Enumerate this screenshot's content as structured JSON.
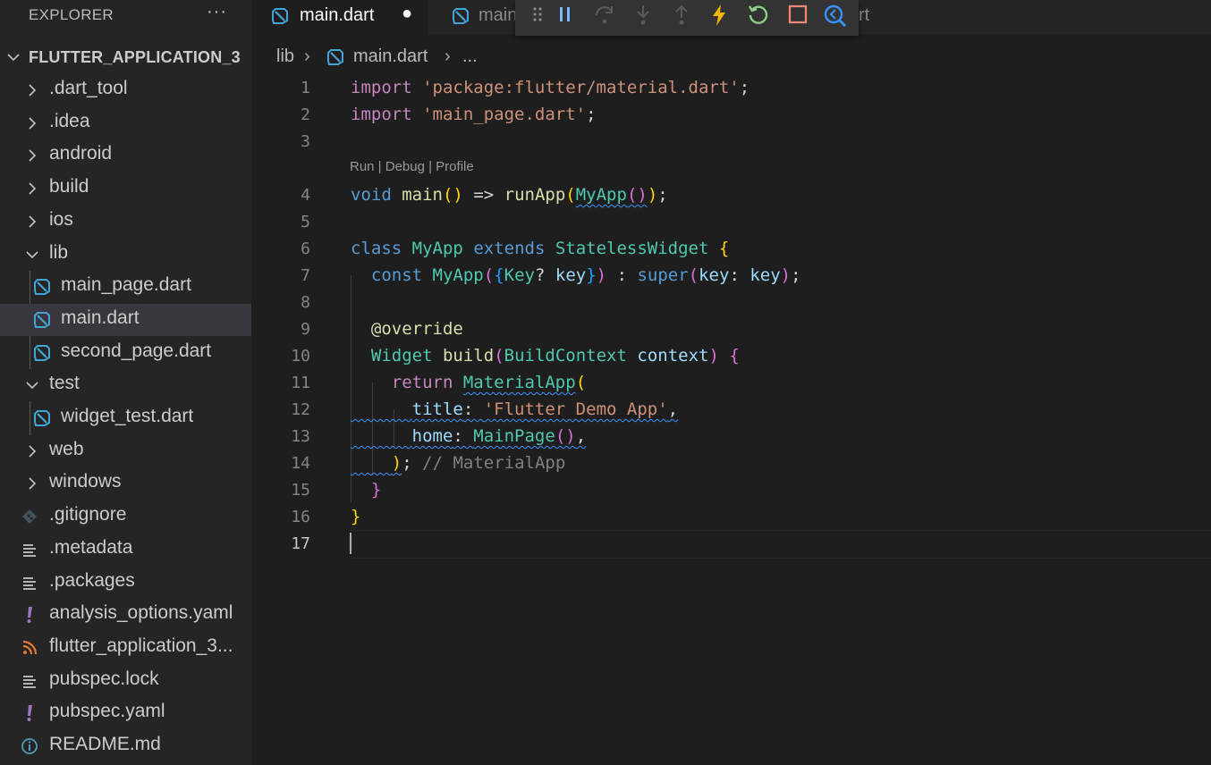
{
  "explorer": {
    "header": "EXPLORER",
    "more": "···",
    "root": "FLUTTER_APPLICATION_3",
    "items": [
      {
        "label": ".dart_tool",
        "kind": "folder",
        "expanded": false,
        "depth": 1
      },
      {
        "label": ".idea",
        "kind": "folder",
        "expanded": false,
        "depth": 1
      },
      {
        "label": "android",
        "kind": "folder",
        "expanded": false,
        "depth": 1
      },
      {
        "label": "build",
        "kind": "folder",
        "expanded": false,
        "depth": 1
      },
      {
        "label": "ios",
        "kind": "folder",
        "expanded": false,
        "depth": 1
      },
      {
        "label": "lib",
        "kind": "folder",
        "expanded": true,
        "depth": 1
      },
      {
        "label": "main_page.dart",
        "kind": "dart",
        "depth": 2
      },
      {
        "label": "main.dart",
        "kind": "dart",
        "depth": 2,
        "selected": true
      },
      {
        "label": "second_page.dart",
        "kind": "dart",
        "depth": 2
      },
      {
        "label": "test",
        "kind": "folder",
        "expanded": true,
        "depth": 1
      },
      {
        "label": "widget_test.dart",
        "kind": "dart",
        "depth": 2
      },
      {
        "label": "web",
        "kind": "folder",
        "expanded": false,
        "depth": 1
      },
      {
        "label": "windows",
        "kind": "folder",
        "expanded": false,
        "depth": 1
      },
      {
        "label": ".gitignore",
        "kind": "git",
        "depth": 1
      },
      {
        "label": ".metadata",
        "kind": "lines",
        "depth": 1
      },
      {
        "label": ".packages",
        "kind": "lines",
        "depth": 1
      },
      {
        "label": "analysis_options.yaml",
        "kind": "yaml",
        "depth": 1
      },
      {
        "label": "flutter_application_3...",
        "kind": "rss",
        "depth": 1
      },
      {
        "label": "pubspec.lock",
        "kind": "lines",
        "depth": 1
      },
      {
        "label": "pubspec.yaml",
        "kind": "yaml",
        "depth": 1
      },
      {
        "label": "README.md",
        "kind": "info",
        "depth": 1
      }
    ]
  },
  "tabs": {
    "active": {
      "label": "main.dart",
      "dirty": "●"
    },
    "second": {
      "label": "main"
    },
    "tail": "rt"
  },
  "breadcrumb": {
    "folder": "lib",
    "sep1": "›",
    "file": "main.dart",
    "sep2": "›",
    "more": "..."
  },
  "codelens": "Run | Debug | Profile",
  "line_numbers": [
    "1",
    "2",
    "3",
    "4",
    "5",
    "6",
    "7",
    "8",
    "9",
    "10",
    "11",
    "12",
    "13",
    "14",
    "15",
    "16",
    "17"
  ],
  "code": {
    "l1": {
      "kw": "import",
      "str": "'package:flutter/material.dart'",
      "end": ";"
    },
    "l2": {
      "kw": "import",
      "str": "'main_page.dart'",
      "end": ";"
    },
    "l4": {
      "kw": "void",
      "fn": "main",
      "p1": "()",
      "op": " => ",
      "fn2": "runApp",
      "b1": "(",
      "cls": "MyApp",
      "b2": "()",
      "b3": ")",
      "end": ";"
    },
    "l6": {
      "kw": "class",
      "cls": "MyApp",
      "kw2": "extends",
      "cls2": "StatelessWidget",
      "b": "{"
    },
    "l7": {
      "kw": "const",
      "cls": "MyApp",
      "b1": "(",
      "b2": "{",
      "cls2": "Key",
      "q": "?",
      "var": "key",
      "b3": "}",
      "b4": ")",
      "colon": " : ",
      "kw2": "super",
      "b5": "(",
      "var2": "key",
      "c": ": ",
      "var3": "key",
      "b6": ")",
      "end": ";"
    },
    "l9": {
      "ann": "@override"
    },
    "l10": {
      "cls": "Widget",
      "fn": "build",
      "b1": "(",
      "cls2": "BuildContext",
      "var": "context",
      "b2": ")",
      "b3": "{"
    },
    "l11": {
      "kw": "return",
      "cls": "MaterialApp",
      "b": "("
    },
    "l12": {
      "var": "title",
      "c": ": ",
      "str": "'Flutter Demo App'",
      "end": ","
    },
    "l13": {
      "var": "home",
      "c": ": ",
      "cls": "MainPage",
      "b": "()",
      "end": ","
    },
    "l14": {
      "b": ")",
      "end": ";",
      "cmt": "// MaterialApp"
    },
    "l15": {
      "b": "}"
    },
    "l16": {
      "b": "}"
    }
  },
  "colors": {
    "accent": "#3794ff",
    "dart": "#41a5d8",
    "yaml": "#a074c4",
    "rss": "#e37933"
  }
}
